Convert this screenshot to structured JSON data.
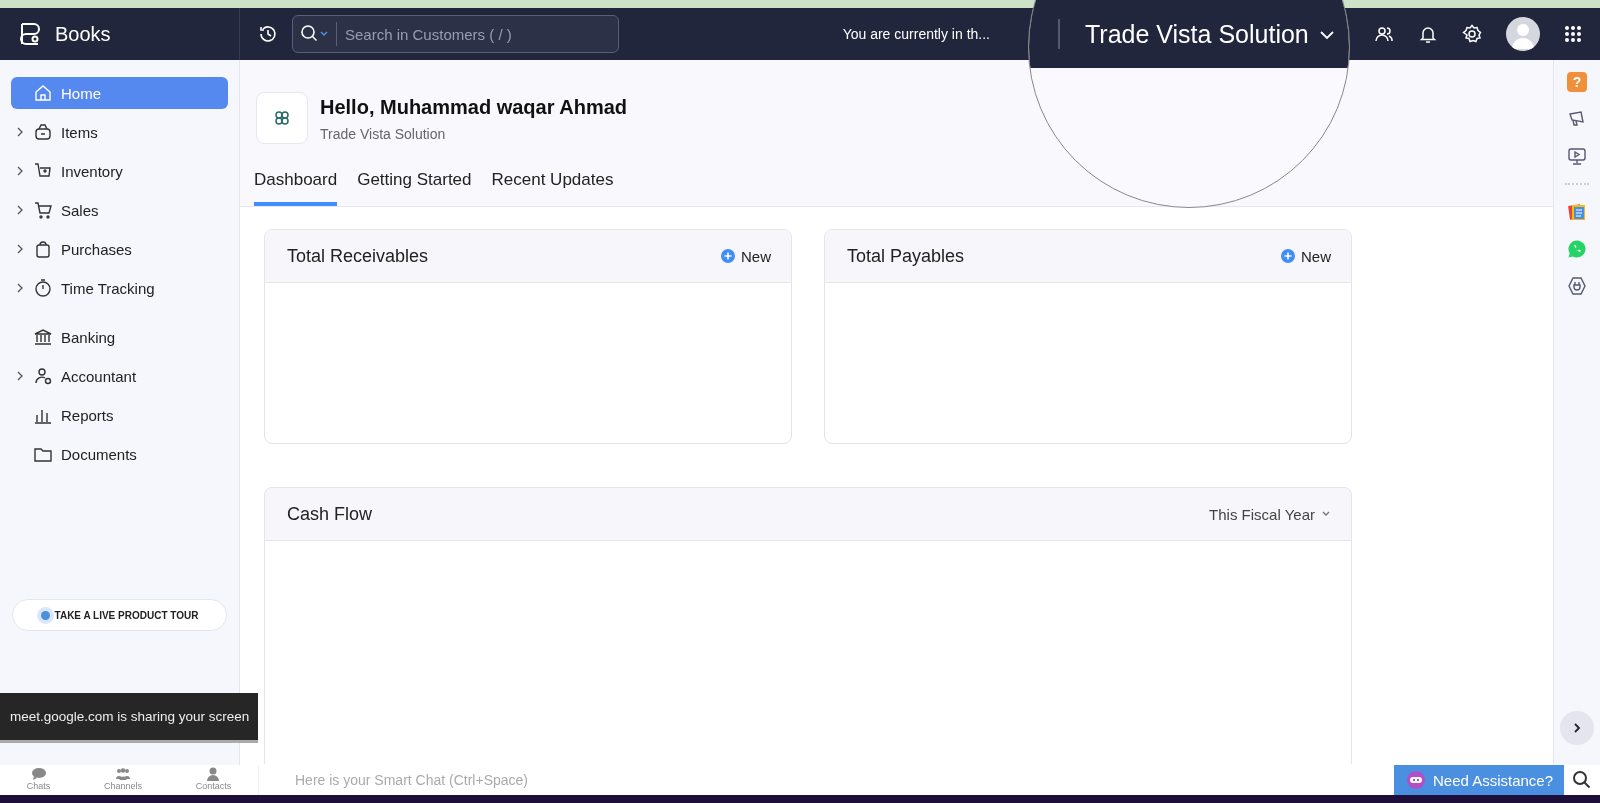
{
  "header": {
    "app_name": "Books",
    "search": {
      "placeholder": "Search in Customers ( / )"
    },
    "org_notice": "You are currently in th...",
    "magnifier": {
      "org_name": "Trade Vista Solution"
    }
  },
  "sidebar": {
    "items": [
      {
        "label": "Home",
        "selected": true,
        "expandable": false
      },
      {
        "label": "Items",
        "selected": false,
        "expandable": true
      },
      {
        "label": "Inventory",
        "selected": false,
        "expandable": true
      },
      {
        "label": "Sales",
        "selected": false,
        "expandable": true
      },
      {
        "label": "Purchases",
        "selected": false,
        "expandable": true
      },
      {
        "label": "Time Tracking",
        "selected": false,
        "expandable": true
      },
      {
        "label": "Banking",
        "selected": false,
        "expandable": false
      },
      {
        "label": "Accountant",
        "selected": false,
        "expandable": true
      },
      {
        "label": "Reports",
        "selected": false,
        "expandable": false
      },
      {
        "label": "Documents",
        "selected": false,
        "expandable": false
      }
    ],
    "tour_button": "TAKE A LIVE PRODUCT TOUR"
  },
  "greeting": {
    "title": "Hello, Muhammad waqar Ahmad",
    "subtitle": "Trade Vista Solution"
  },
  "tabs": [
    {
      "label": "Dashboard",
      "selected": true
    },
    {
      "label": "Getting Started",
      "selected": false
    },
    {
      "label": "Recent Updates",
      "selected": false
    }
  ],
  "cards": [
    {
      "title": "Total Receivables",
      "action": "New"
    },
    {
      "title": "Total Payables",
      "action": "New"
    }
  ],
  "cash_flow": {
    "title": "Cash Flow",
    "period": "This Fiscal Year"
  },
  "right_rail": {
    "help": "?"
  },
  "chat_bar": {
    "tabs": [
      "Chats",
      "Channels",
      "Contacts"
    ],
    "placeholder": "Here is your Smart Chat (Ctrl+Space)"
  },
  "assist_button": "Need Assistance?",
  "share_banner": "meet.google.com is sharing your screen"
}
